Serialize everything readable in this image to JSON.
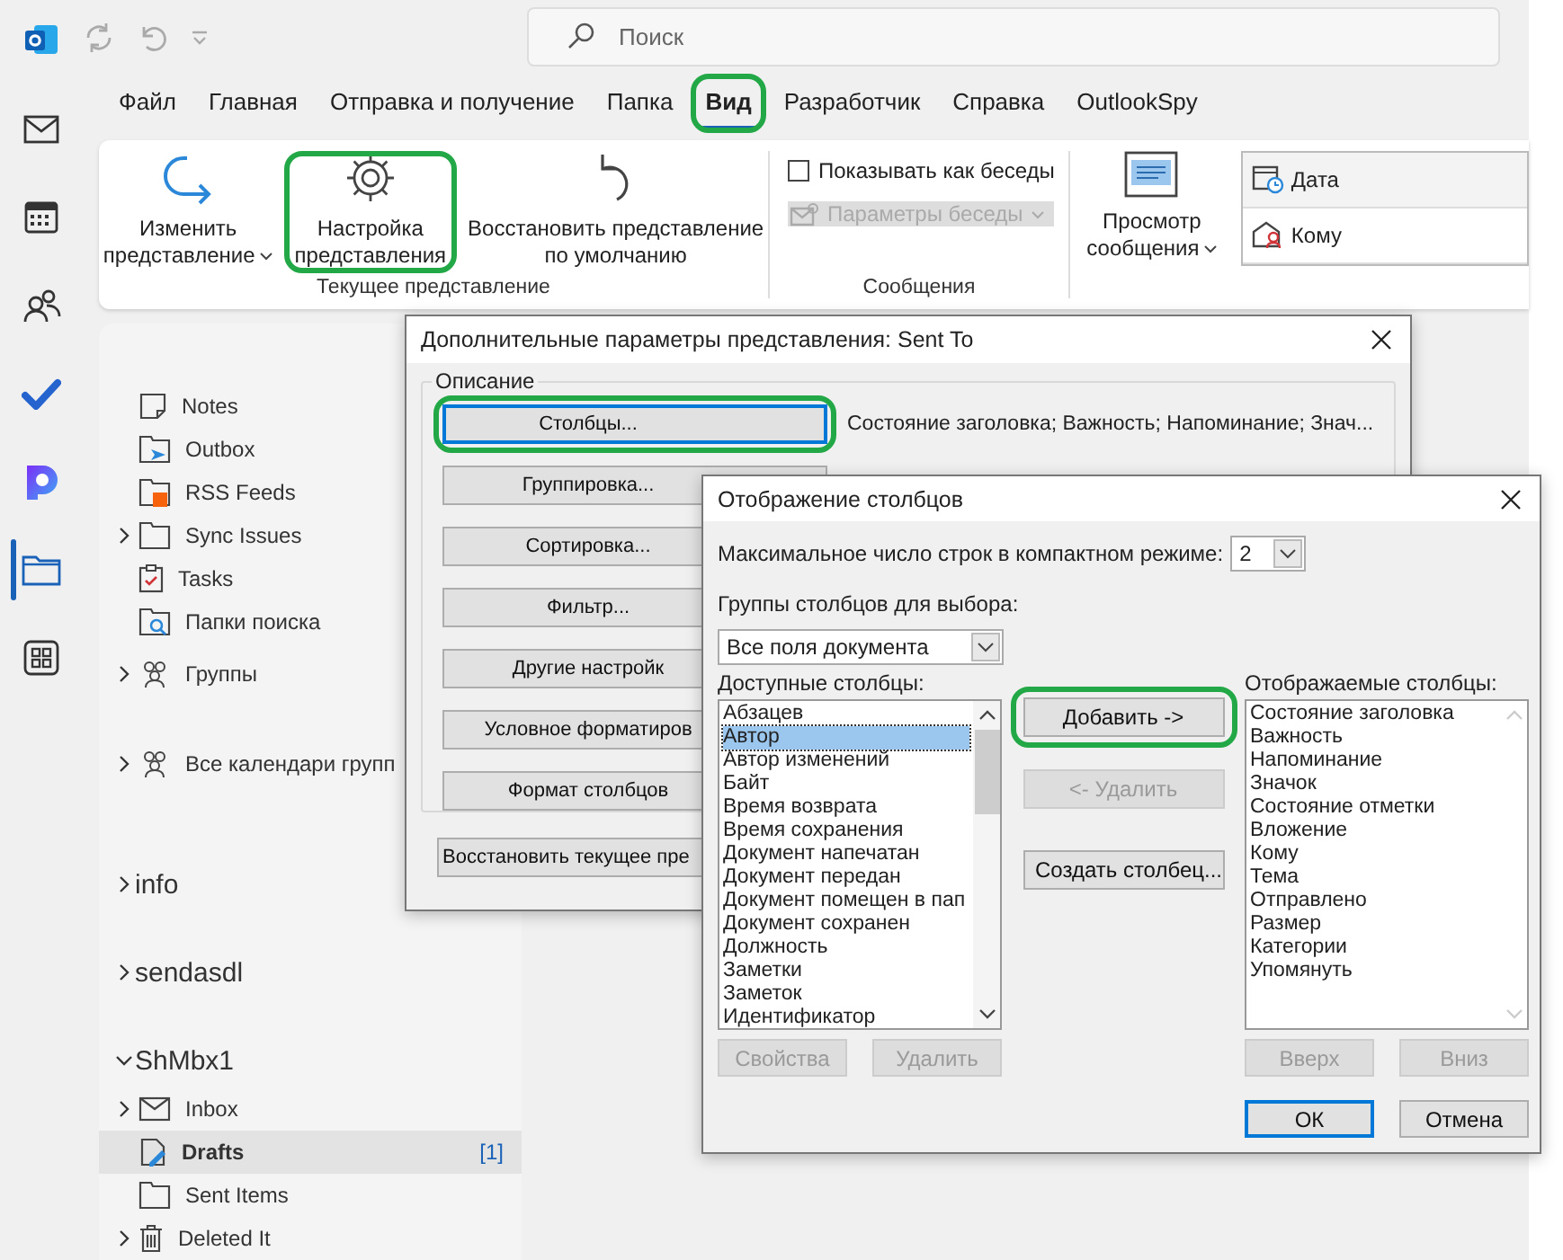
{
  "search": {
    "placeholder": "Поиск"
  },
  "nav_rail": [
    {
      "selected": false
    },
    {
      "selected": false
    },
    {
      "selected": false
    },
    {
      "selected": false
    },
    {
      "selected": false
    },
    {
      "selected": true
    },
    {
      "selected": false
    }
  ],
  "tabs": [
    {
      "label": "Файл",
      "selected": false,
      "highlighted": false
    },
    {
      "label": "Главная",
      "selected": false,
      "highlighted": false
    },
    {
      "label": "Отправка и получение",
      "selected": false,
      "highlighted": false
    },
    {
      "label": "Папка",
      "selected": false,
      "highlighted": false
    },
    {
      "label": "Вид",
      "selected": true,
      "highlighted": true
    },
    {
      "label": "Разработчик",
      "selected": false,
      "highlighted": false
    },
    {
      "label": "Справка",
      "selected": false,
      "highlighted": false
    },
    {
      "label": "OutlookSpy",
      "selected": false,
      "highlighted": false
    }
  ],
  "ribbon": {
    "current_view": {
      "title": "Текущее представление",
      "buttons": [
        {
          "lines": [
            "Изменить",
            "представление"
          ],
          "dropdown": true,
          "highlighted": false
        },
        {
          "lines": [
            "Настройка",
            "представления"
          ],
          "dropdown": false,
          "highlighted": true
        },
        {
          "lines": [
            "Восстановить представление",
            "по умолчанию"
          ],
          "dropdown": false,
          "highlighted": false
        }
      ]
    },
    "messages": {
      "title": "Сообщения",
      "show_conversations": {
        "label": "Показывать как беседы",
        "checked": false
      },
      "conversation_settings": {
        "label": "Параметры беседы",
        "disabled": true
      }
    },
    "reading_pane": {
      "lines": [
        "Просмотр",
        "сообщения"
      ]
    },
    "arrangement": [
      {
        "label": "Дата",
        "selected": true
      },
      {
        "label": "Кому",
        "selected": false
      }
    ]
  },
  "folders": [
    {
      "kind": "folder",
      "label": "Notes",
      "has_children": false,
      "selected": false
    },
    {
      "kind": "folder",
      "label": "Outbox",
      "has_children": false,
      "selected": false
    },
    {
      "kind": "folder",
      "label": "RSS Feeds",
      "has_children": false,
      "selected": false
    },
    {
      "kind": "folder",
      "label": "Sync Issues",
      "has_children": true,
      "expanded": false,
      "selected": false
    },
    {
      "kind": "folder",
      "label": "Tasks",
      "has_children": false,
      "selected": false
    },
    {
      "kind": "folder",
      "label": "Папки поиска",
      "has_children": false,
      "selected": false
    },
    {
      "kind": "group",
      "label": "Группы",
      "has_children": true,
      "expanded": false,
      "selected": false
    },
    {
      "kind": "group",
      "label": "Все календари групп",
      "has_children": true,
      "expanded": false,
      "selected": false
    },
    {
      "kind": "account",
      "label": "info",
      "has_children": true,
      "expanded": false,
      "selected": false
    },
    {
      "kind": "account",
      "label": "sendasdl",
      "has_children": true,
      "expanded": false,
      "selected": false
    },
    {
      "kind": "account",
      "label": "ShMbx1",
      "has_children": true,
      "expanded": true,
      "selected": false
    },
    {
      "kind": "folder",
      "label": "Inbox",
      "has_children": true,
      "expanded": false,
      "selected": false
    },
    {
      "kind": "folder",
      "label": "Drafts",
      "has_children": false,
      "selected": true,
      "count": "[1]"
    },
    {
      "kind": "folder",
      "label": "Sent Items",
      "has_children": false,
      "selected": false
    },
    {
      "kind": "folder",
      "label": "Deleted It",
      "has_children": true,
      "expanded": false,
      "selected": false
    }
  ],
  "view_dialog": {
    "title": "Дополнительные параметры представления: Sent To",
    "section": "Описание",
    "buttons": [
      {
        "label": "Столбцы...",
        "highlighted": true,
        "focused": true
      },
      {
        "label": "Группировка...",
        "highlighted": false,
        "focused": false
      },
      {
        "label": "Сортировка...",
        "highlighted": false,
        "focused": false
      },
      {
        "label": "Фильтр...",
        "highlighted": false,
        "focused": false
      },
      {
        "label": "Другие настройк",
        "highlighted": false,
        "focused": false
      },
      {
        "label": "Условное форматиров",
        "highlighted": false,
        "focused": false
      },
      {
        "label": "Формат столбцов",
        "highlighted": false,
        "focused": false
      }
    ],
    "columns_summary": "Состояние заголовка; Важность; Напоминание; Знач...",
    "reset_button": "Восстановить текущее пре"
  },
  "columns_dialog": {
    "title": "Отображение столбцов",
    "max_rows_label": "Максимальное число строк в компактном режиме:",
    "max_rows_value": "2",
    "groups_label": "Группы столбцов для выбора:",
    "groups_value": "Все поля документа",
    "available_label": "Доступные столбцы:",
    "shown_label": "Отображаемые столбцы:",
    "available": [
      {
        "label": "Абзацев",
        "selected": false
      },
      {
        "label": "Автор",
        "selected": true
      },
      {
        "label": "Автор изменений",
        "selected": false
      },
      {
        "label": "Байт",
        "selected": false
      },
      {
        "label": "Время возврата",
        "selected": false
      },
      {
        "label": "Время сохранения",
        "selected": false
      },
      {
        "label": "Документ напечатан",
        "selected": false
      },
      {
        "label": "Документ передан",
        "selected": false
      },
      {
        "label": "Документ помещен в пап",
        "selected": false
      },
      {
        "label": "Документ сохранен",
        "selected": false
      },
      {
        "label": "Должность",
        "selected": false
      },
      {
        "label": "Заметки",
        "selected": false
      },
      {
        "label": "Заметок",
        "selected": false
      },
      {
        "label": "Идентификатор",
        "selected": false
      }
    ],
    "shown": [
      "Состояние заголовка",
      "Важность",
      "Напоминание",
      "Значок",
      "Состояние отметки",
      "Вложение",
      "Кому",
      "Тема",
      "Отправлено",
      "Размер",
      "Категории",
      "Упомянуть"
    ],
    "middle_buttons": [
      {
        "label": "Добавить ->",
        "disabled": false,
        "highlighted": true
      },
      {
        "label": "<- Удалить",
        "disabled": true,
        "highlighted": false
      },
      {
        "label": "Создать столбец...",
        "disabled": false,
        "highlighted": false
      }
    ],
    "left_buttons": [
      {
        "label": "Свойства",
        "disabled": true
      },
      {
        "label": "Удалить",
        "disabled": true
      }
    ],
    "right_buttons": [
      {
        "label": "Вверх",
        "disabled": true
      },
      {
        "label": "Вниз",
        "disabled": true
      }
    ],
    "footer_buttons": [
      {
        "label": "ОК",
        "default": true
      },
      {
        "label": "Отмена",
        "default": false
      }
    ]
  }
}
